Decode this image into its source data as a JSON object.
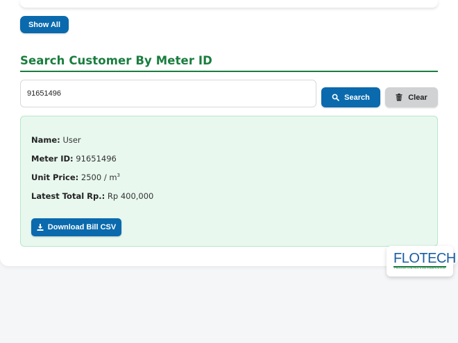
{
  "show_all_label": "Show All",
  "section": {
    "title": "Search Customer By Meter ID"
  },
  "search": {
    "value": "91651496",
    "search_label": "Search",
    "clear_label": "Clear"
  },
  "result": {
    "name_label": "Name:",
    "name_value": "User",
    "meter_label": "Meter ID:",
    "meter_value": "91651496",
    "price_label": "Unit Price:",
    "price_value": "2500 / m",
    "price_unit_exp": "3",
    "total_label": "Latest Total Rp.:",
    "total_value": "Rp 400,000",
    "download_label": "Download Bill CSV"
  },
  "logo": {
    "text": "FLOTECH",
    "subtitle": "PROCESS CONTROL & INSTRUMENTATION"
  },
  "colors": {
    "primary_blue": "#0a6aad",
    "heading_green": "#1a7d3e",
    "result_bg": "#e8f8ef",
    "clear_gray": "#d0d2d4"
  },
  "icons": {
    "search_button": "search-icon",
    "clear_button": "trash-icon",
    "download_button": "download-icon"
  }
}
